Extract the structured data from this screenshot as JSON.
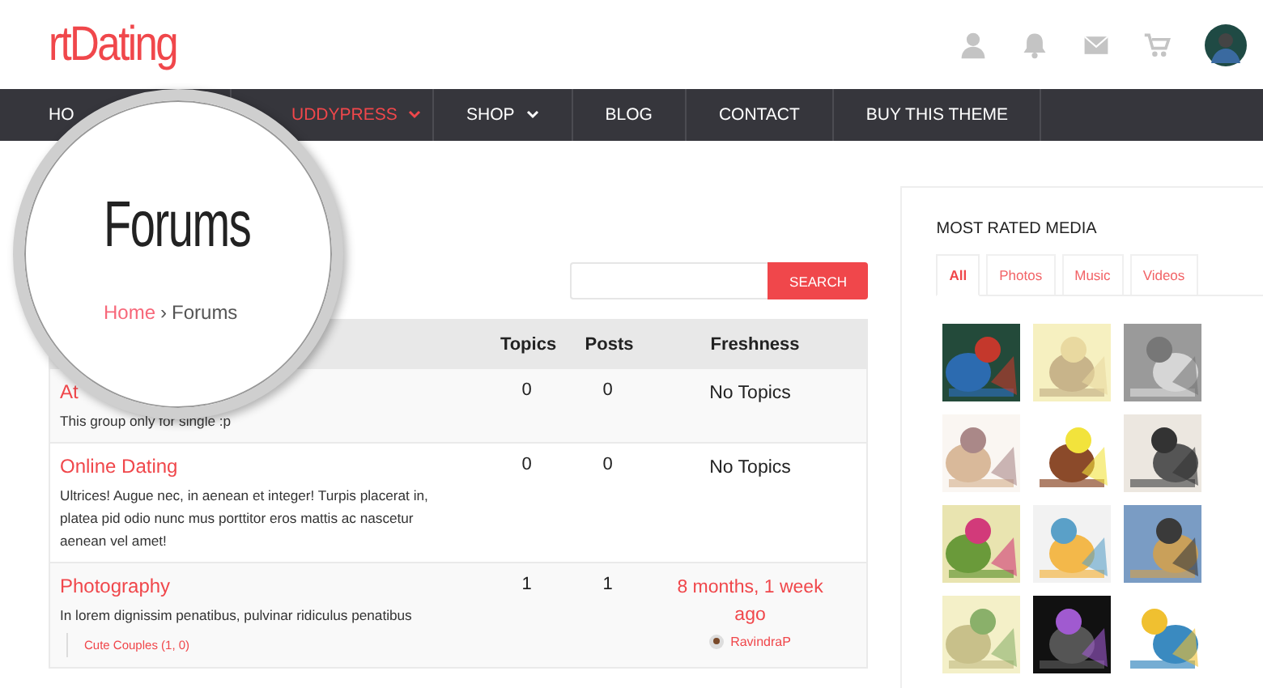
{
  "logo": "rtDating",
  "nav": [
    {
      "label": "HO",
      "dropdown": false,
      "selected": false
    },
    {
      "label": "UDDYPRESS",
      "dropdown": true,
      "selected": true
    },
    {
      "label": "SHOP",
      "dropdown": true,
      "selected": false
    },
    {
      "label": "BLOG",
      "dropdown": false,
      "selected": false
    },
    {
      "label": "CONTACT",
      "dropdown": false,
      "selected": false
    },
    {
      "label": "BUY THIS THEME",
      "dropdown": false,
      "selected": false
    }
  ],
  "page_title": "Forums",
  "breadcrumb": {
    "home": "Home",
    "separator": "›",
    "current": "Forums"
  },
  "search": {
    "button": "SEARCH"
  },
  "table": {
    "columns": [
      "Topics",
      "Posts",
      "Freshness"
    ],
    "rows": [
      {
        "title": "At",
        "description": "This group only for single :p",
        "topics": "0",
        "posts": "0",
        "freshness": "No Topics",
        "freshness_link": false
      },
      {
        "title": "Online Dating",
        "description": "Ultrices! Augue nec, in aenean et integer! Turpis placerat in, platea pid odio nunc mus porttitor eros mattis ac nascetur aenean vel amet!",
        "topics": "0",
        "posts": "0",
        "freshness": "No Topics",
        "freshness_link": false
      },
      {
        "title": "Photography",
        "description": "In lorem dignissim penatibus, pulvinar ridiculus penatibus",
        "topics": "1",
        "posts": "1",
        "freshness": "8 months, 1 week ago",
        "freshness_link": true,
        "author": "RavindraP",
        "subforums": [
          "Cute Couples (1, 0)"
        ]
      }
    ]
  },
  "sidebar": {
    "title": "MOST RATED MEDIA",
    "tabs": [
      {
        "label": "All",
        "selected": true
      },
      {
        "label": "Photos",
        "selected": false
      },
      {
        "label": "Music",
        "selected": false
      },
      {
        "label": "Videos",
        "selected": false
      }
    ]
  }
}
